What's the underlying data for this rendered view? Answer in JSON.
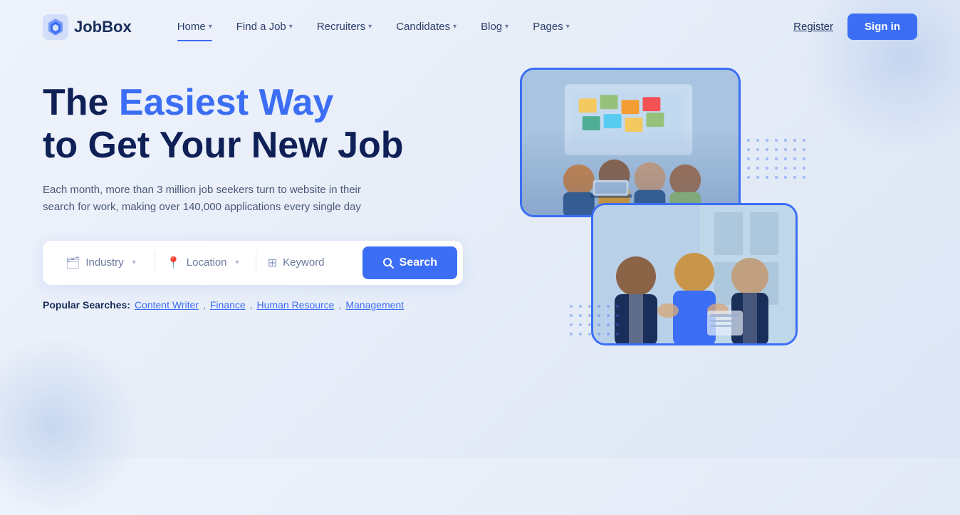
{
  "logo": {
    "text": "JobBox"
  },
  "nav": {
    "links": [
      {
        "label": "Home",
        "active": true
      },
      {
        "label": "Find a Job",
        "active": false
      },
      {
        "label": "Recruiters",
        "active": false
      },
      {
        "label": "Candidates",
        "active": false
      },
      {
        "label": "Blog",
        "active": false
      },
      {
        "label": "Pages",
        "active": false
      }
    ],
    "register": "Register",
    "signin": "Sign in"
  },
  "hero": {
    "title_prefix": "The ",
    "title_highlight": "Easiest Way",
    "title_suffix": "to Get Your New Job",
    "subtitle": "Each month, more than 3 million job seekers turn to website in their search for work, making over 140,000 applications every single day"
  },
  "search": {
    "industry_label": "Industry",
    "location_label": "Location",
    "keyword_placeholder": "Keyword",
    "button_label": "Search"
  },
  "popular": {
    "label": "Popular Searches:",
    "items": [
      {
        "text": "Content Writer",
        "separator": ","
      },
      {
        "text": "Finance",
        "separator": ","
      },
      {
        "text": "Human Resource",
        "separator": ","
      },
      {
        "text": "Management",
        "separator": ""
      }
    ]
  },
  "colors": {
    "accent": "#3b6ef5",
    "dark": "#0f2057",
    "mid": "#2d3e6e"
  }
}
